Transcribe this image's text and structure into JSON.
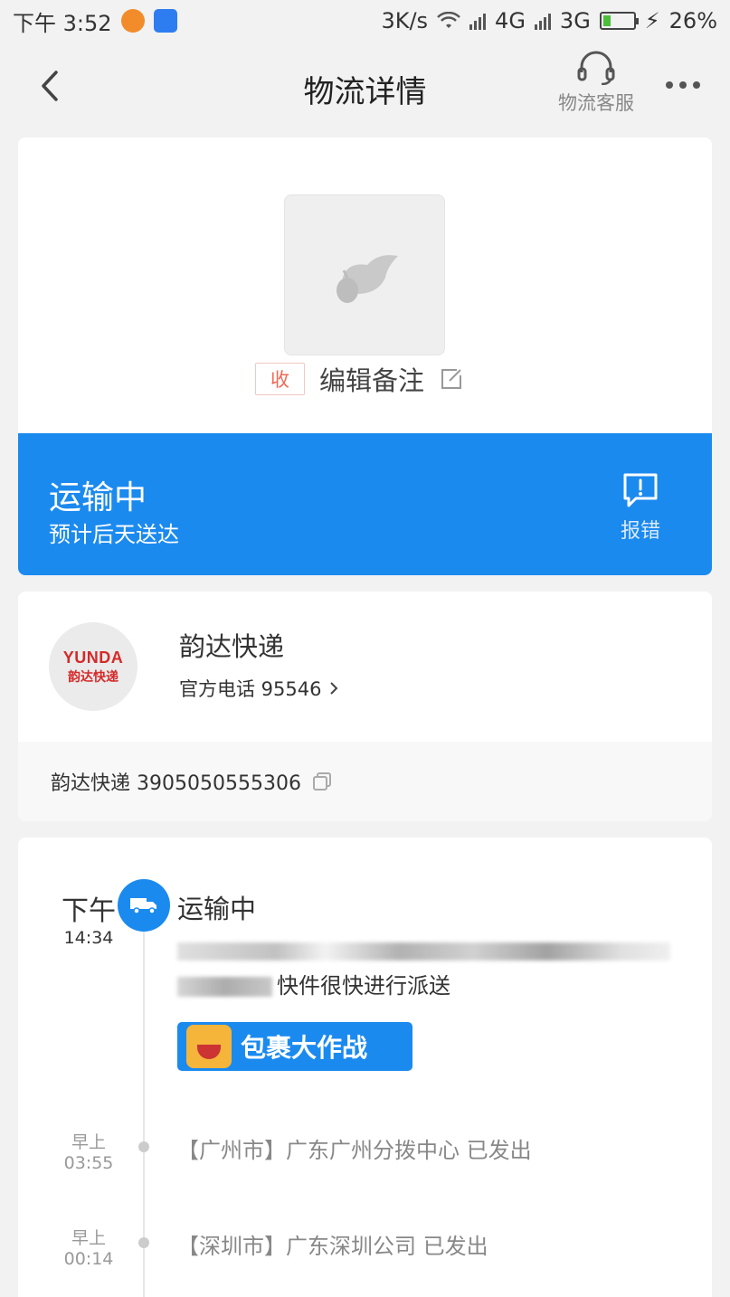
{
  "status_bar": {
    "time": "下午 3:52",
    "net_speed": "3K/s",
    "net1": "4G",
    "net2": "3G",
    "battery": "26%",
    "battery_level": 0.26
  },
  "header": {
    "title": "物流详情",
    "customer_service_label": "物流客服"
  },
  "package": {
    "tag": "收",
    "edit_remark": "编辑备注"
  },
  "status": {
    "title": "运输中",
    "eta": "预计后天送达",
    "report_label": "报错"
  },
  "courier": {
    "logo_en": "YUNDA",
    "logo_cn": "韵达快递",
    "name": "韵达快递",
    "phone_label": "官方电话 95546",
    "tracking": "韵达快递 3905050555306"
  },
  "timeline": {
    "current": {
      "day": "下午",
      "time": "14:34",
      "status": "运输中",
      "desc": "快件很快进行派送"
    },
    "promo": "包裹大作战",
    "entries": [
      {
        "day": "早上",
        "time": "03:55",
        "text": "【广州市】广东广州分拨中心 已发出"
      },
      {
        "day": "早上",
        "time": "00:14",
        "text": "【深圳市】广东深圳公司 已发出"
      }
    ]
  },
  "colors": {
    "accent": "#1b8aef",
    "tag_red": "#ee6a55",
    "brand_red": "#d42a2a"
  }
}
